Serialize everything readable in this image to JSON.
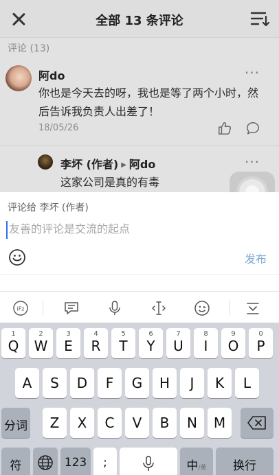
{
  "header": {
    "title": "全部 13 条评论",
    "close_icon": "close-icon",
    "sort_icon": "sort-icon"
  },
  "section_label": "评论 (13)",
  "comments": [
    {
      "author": "阿do",
      "text": "你也是今天去的呀，我也是等了两个小时，然后告诉我负责人出差了！",
      "date": "18/05/26",
      "more": "···"
    }
  ],
  "reply": {
    "author": "李坏 (作者)",
    "to": "阿do",
    "text": "这家公司是真的有毒",
    "more": "···"
  },
  "composer": {
    "reply_to_label": "评论给 李坏 (作者)",
    "placeholder": "友善的评论是交流的起点",
    "publish_label": "发布"
  },
  "keyboard": {
    "row1": [
      {
        "num": "1",
        "ch": "Q"
      },
      {
        "num": "2",
        "ch": "W"
      },
      {
        "num": "3",
        "ch": "E"
      },
      {
        "num": "4",
        "ch": "R"
      },
      {
        "num": "5",
        "ch": "T"
      },
      {
        "num": "6",
        "ch": "Y"
      },
      {
        "num": "7",
        "ch": "U"
      },
      {
        "num": "8",
        "ch": "I"
      },
      {
        "num": "9",
        "ch": "O"
      },
      {
        "num": "0",
        "ch": "P"
      }
    ],
    "row2": [
      "A",
      "S",
      "D",
      "F",
      "G",
      "H",
      "J",
      "K",
      "L"
    ],
    "row3": [
      "Z",
      "X",
      "C",
      "V",
      "B",
      "N",
      "M"
    ],
    "fenci": "分词",
    "fu": "符",
    "num_key": "123",
    "semicolon": ";",
    "lang_main": "中",
    "lang_sub": "/英",
    "newline": "换行"
  },
  "colors": {
    "accent": "#2f6df6",
    "publish": "#7ea9d6",
    "overlay_bg": "#e2e2e2",
    "keyboard_bg": "#d1d4da"
  }
}
